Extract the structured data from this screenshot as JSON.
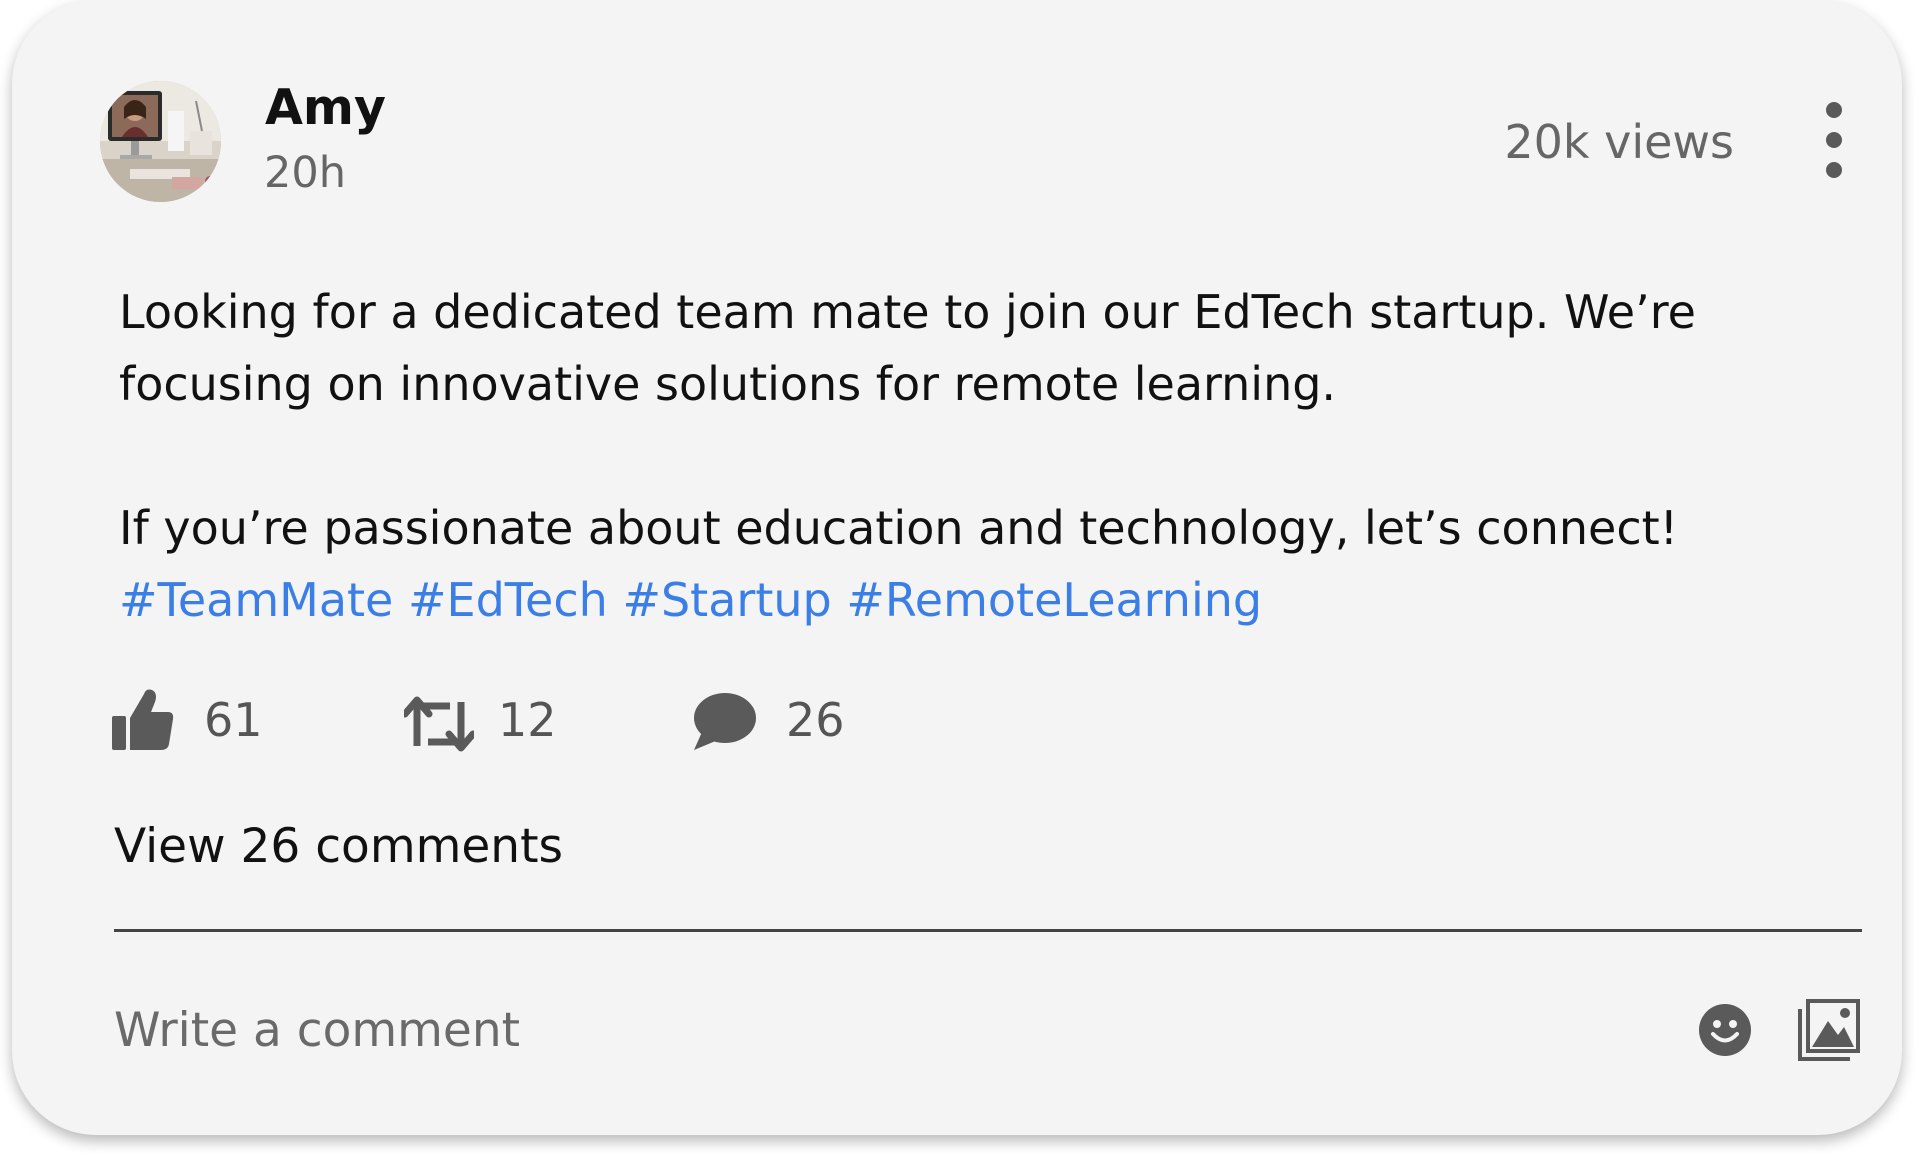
{
  "post": {
    "author": "Amy",
    "time": "20h",
    "views": "20k views",
    "body_line_1": "Looking for a dedicated team mate to join our EdTech startup. We’re",
    "body_line_2": "focusing on innovative solutions for remote learning.",
    "body_line_3": "If you’re passionate about education and technology, let’s connect!",
    "hashtags": [
      "#TeamMate",
      "#EdTech",
      "#Startup",
      "#RemoteLearning"
    ]
  },
  "actions": {
    "likes": "61",
    "reposts": "12",
    "comments": "26"
  },
  "comments": {
    "view_label": "View 26 comments",
    "input_placeholder": "Write a comment"
  },
  "icons": {
    "avatar": "avatar-photo",
    "more": "more-vertical-icon",
    "like": "thumbs-up-icon",
    "repost": "repost-icon",
    "comment": "comment-bubble-icon",
    "emoji": "emoji-icon",
    "image": "image-gallery-icon"
  },
  "colors": {
    "card_background": "#f4f4f4",
    "hashtag": "#3a7ee6",
    "icon": "#5a5a5a",
    "muted_text": "#666666"
  }
}
